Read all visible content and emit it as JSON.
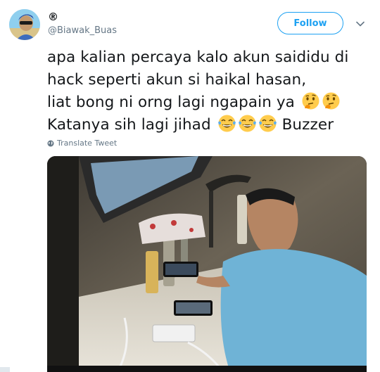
{
  "tweet": {
    "display_name": "®",
    "username": "@Biawak_Buas",
    "follow_label": "Follow",
    "lines": [
      "apa kalian percaya kalo akun saididu di",
      "hack seperti akun si haikal hasan,",
      "liat bong ni orng lagi ngapain ya",
      "Katanya sih lagi jihad",
      "Buzzer"
    ],
    "translate_label": "Translate Tweet"
  },
  "colors": {
    "accent": "#1da1f2",
    "text": "#14171a",
    "secondary": "#657786"
  },
  "icons": {
    "caret": "chevron-down-icon",
    "globe": "globe-icon",
    "thinking": "thinking-face-emoji",
    "laughing": "tears-of-joy-emoji"
  }
}
